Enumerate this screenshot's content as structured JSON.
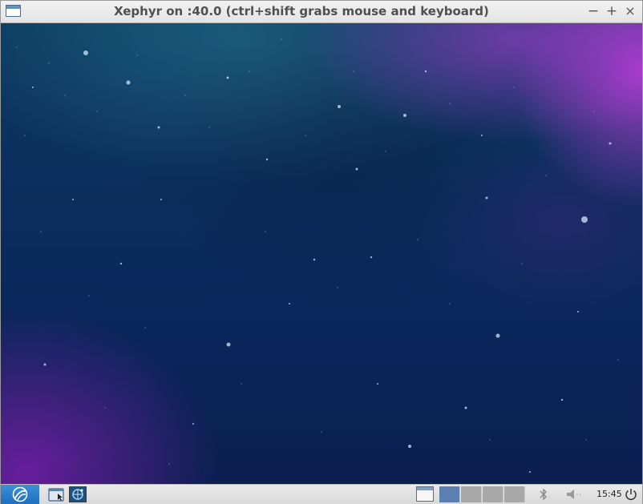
{
  "window": {
    "title": "Xephyr on :40.0 (ctrl+shift grabs mouse and keyboard)",
    "buttons": {
      "minimize": "−",
      "maximize": "+",
      "close": "×"
    }
  },
  "taskbar": {
    "clock": "15:45",
    "icons": {
      "menu": "lxqt-menu-icon",
      "file_manager": "file-manager-icon",
      "browser": "browser-icon",
      "show_desktop": "window-list-icon",
      "bluetooth": "bluetooth-icon",
      "volume": "volume-muted-icon",
      "power": "power-icon"
    },
    "workspaces": {
      "count": 4,
      "active": 1
    }
  },
  "colors": {
    "menu_button": "#2a7fcf",
    "active_workspace": "#5b7fae",
    "inactive_workspace": "#a8a8a8",
    "desktop_base": "#0b2d5d",
    "nebula_purple": "#be3cdc"
  }
}
